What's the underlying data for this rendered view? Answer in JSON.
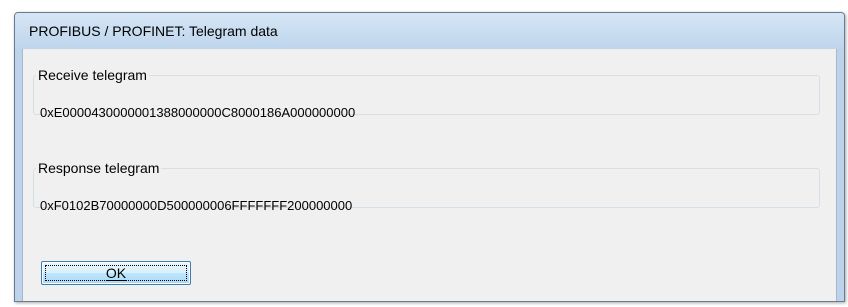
{
  "window": {
    "title": "PROFIBUS / PROFINET: Telegram data"
  },
  "receive": {
    "label": "Receive telegram",
    "value": "0xE0000430000001388000000C8000186A000000000"
  },
  "response": {
    "label": "Response telegram",
    "value": "0xF0102B70000000D500000006FFFFFFF200000000"
  },
  "buttons": {
    "ok_label": "OK"
  }
}
